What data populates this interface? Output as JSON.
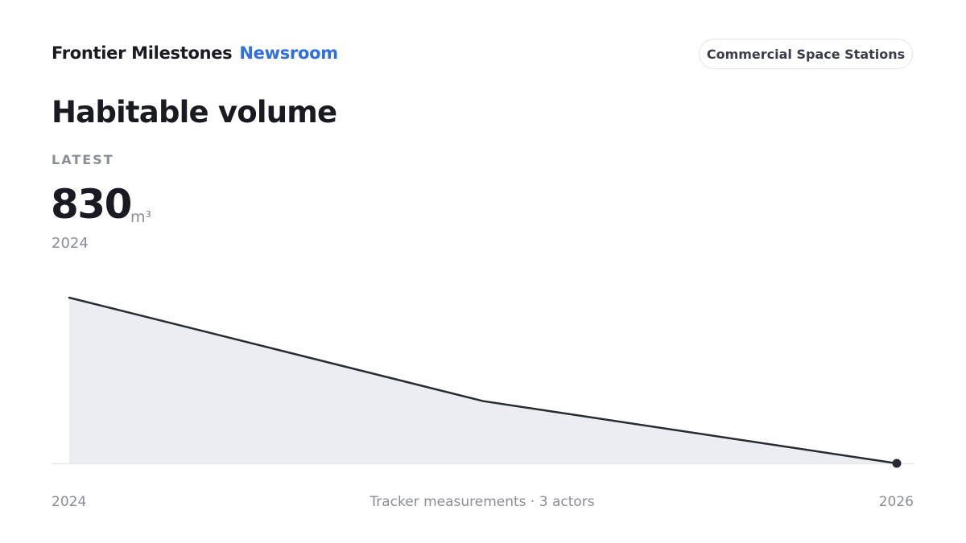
{
  "header": {
    "brand_name": "Frontier Milestones",
    "brand_section": "Newsroom",
    "topic": "Commercial Space Stations"
  },
  "metric": {
    "title": "Habitable volume",
    "latest_label": "LATEST",
    "latest_value": "830",
    "unit": "m³",
    "latest_year": "2024"
  },
  "footer": {
    "x_start": "2024",
    "x_end": "2026",
    "caption": "Tracker measurements · 3 actors"
  },
  "colors": {
    "brand_accent": "#2f6fe0",
    "line": "#262a33",
    "area_fill": "#ecedf1",
    "baseline": "#e6e7ec"
  },
  "chart_data": {
    "type": "area",
    "x": [
      2024,
      2025,
      2026
    ],
    "values": [
      830,
      312,
      0
    ],
    "xlabel": "",
    "ylabel": "",
    "ylim": [
      0,
      830
    ],
    "highlight": "last",
    "grid": false,
    "legend": "none"
  }
}
